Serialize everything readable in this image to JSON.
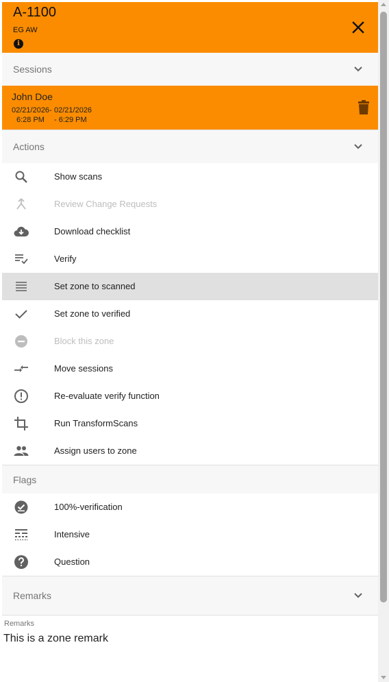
{
  "header": {
    "title": "A-1100",
    "subtitle": "EG AW",
    "info_glyph": "i",
    "close_icon": "close-icon",
    "background": "#fb8c00"
  },
  "sessions": {
    "title": "Sessions",
    "items": [
      {
        "user": "John Doe",
        "start_date": "02/21/2026-",
        "start_time": "6:28 PM",
        "end_date": "02/21/2026",
        "end_time": "- 6:29 PM",
        "delete_icon": "trash-icon"
      }
    ]
  },
  "actions": {
    "title": "Actions",
    "items": [
      {
        "label": "Show scans",
        "icon": "search-icon",
        "enabled": true
      },
      {
        "label": "Review Change Requests",
        "icon": "merge-icon",
        "enabled": false
      },
      {
        "label": "Download checklist",
        "icon": "cloud-download-icon",
        "enabled": true
      },
      {
        "label": "Verify",
        "icon": "playlist-check-icon",
        "enabled": true
      },
      {
        "label": "Set zone to scanned",
        "icon": "list-icon",
        "enabled": true,
        "highlighted": true
      },
      {
        "label": "Set zone to verified",
        "icon": "check-icon",
        "enabled": true
      },
      {
        "label": "Block this zone",
        "icon": "block-icon",
        "enabled": false
      },
      {
        "label": "Move sessions",
        "icon": "compare-arrows-icon",
        "enabled": true
      },
      {
        "label": "Re-evaluate verify function",
        "icon": "alert-circle-icon",
        "enabled": true
      },
      {
        "label": "Run TransformScans",
        "icon": "crop-icon",
        "enabled": true
      },
      {
        "label": "Assign users to zone",
        "icon": "people-icon",
        "enabled": true
      }
    ]
  },
  "flags": {
    "title": "Flags",
    "items": [
      {
        "label": "100%-verification",
        "icon": "check-circle-icon"
      },
      {
        "label": "Intensive",
        "icon": "line-style-icon"
      },
      {
        "label": "Question",
        "icon": "help-icon"
      }
    ]
  },
  "remarks": {
    "title": "Remarks",
    "field_label": "Remarks",
    "value": "This is a zone remark"
  },
  "colors": {
    "accent": "#fb8c00",
    "section_bg": "#f7f7f7",
    "highlight": "#e0e0e0",
    "icon": "#616161",
    "disabled": "#bdbdbd"
  }
}
